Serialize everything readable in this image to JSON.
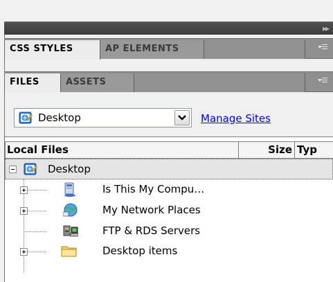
{
  "panels": {
    "collapse_glyph": "▸▸",
    "tab_group_1": {
      "tabs": [
        {
          "label": "CSS STYLES",
          "active": true
        },
        {
          "label": "AP ELEMENTS",
          "active": false
        }
      ],
      "menu_icon": "panel-options-icon"
    },
    "tab_group_2": {
      "tabs": [
        {
          "label": "FILES",
          "active": true
        },
        {
          "label": "ASSETS",
          "active": false
        }
      ],
      "menu_icon": "panel-options-icon"
    }
  },
  "files": {
    "site_select": {
      "value": "Desktop",
      "icon": "site-desktop-icon"
    },
    "manage_sites_label": "Manage Sites",
    "columns": {
      "local": "Local Files",
      "size": "Size",
      "type": "Typ"
    },
    "tree": [
      {
        "label": "Desktop",
        "icon": "site-desktop-icon",
        "expander": "minus",
        "selected": true
      },
      {
        "label": "Is This My Compu…",
        "icon": "computer-icon",
        "expander": "plus"
      },
      {
        "label": "My Network Places",
        "icon": "network-places-icon",
        "expander": "plus"
      },
      {
        "label": "FTP & RDS Servers",
        "icon": "ftp-servers-icon",
        "expander": "none"
      },
      {
        "label": "Desktop items",
        "icon": "folder-icon",
        "expander": "plus"
      }
    ]
  },
  "colors": {
    "link": "#0000ee",
    "panel_strip": "#454545",
    "tab_bar": "#8f8f8f"
  }
}
